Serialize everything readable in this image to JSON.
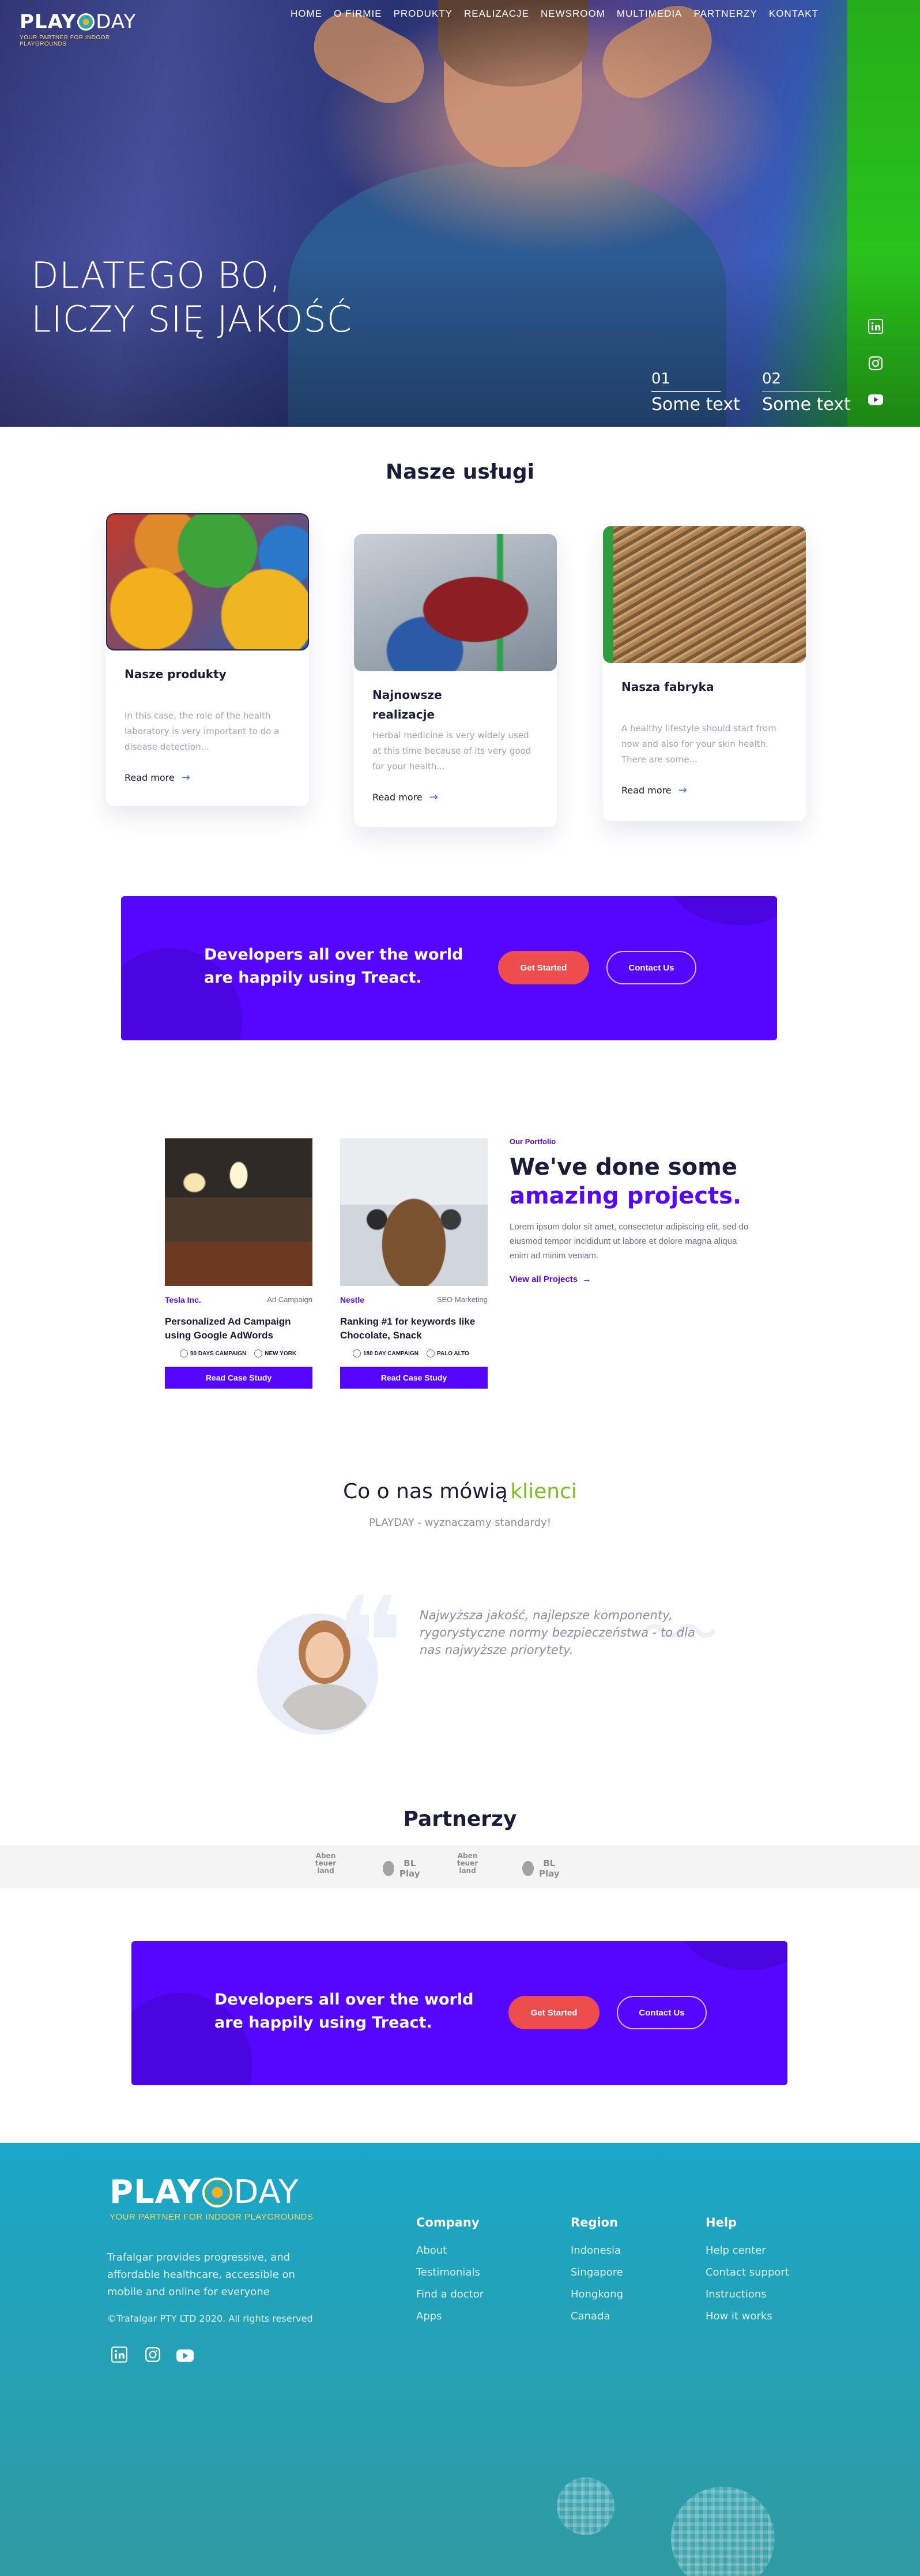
{
  "brand": {
    "name_left": "PLAY",
    "name_right": "DAY",
    "tagline": "YOUR PARTNER FOR INDOOR PLAYGROUNDS"
  },
  "nav": {
    "items": [
      "HOME",
      "O FIRMIE",
      "PRODUKTY",
      "REALIZACJE",
      "NEWSROOM",
      "MULTIMEDIA",
      "PARTNERZY",
      "KONTAKT"
    ]
  },
  "hero": {
    "title_line1": "DLATEGO BO,",
    "title_line2": "LICZY SIĘ JAKOŚĆ",
    "slides": [
      {
        "num": "01",
        "text": "Some text"
      },
      {
        "num": "02",
        "text": "Some text"
      }
    ]
  },
  "services": {
    "title": "Nasze usługi",
    "cards": [
      {
        "title": "Nasze produkty",
        "body": "In this case, the role of the health laboratory is very important to do a disease detection...",
        "link": "Read more"
      },
      {
        "title": "Najnowsze realizacje",
        "body": "Herbal medicine is very widely used at this time because of its very good for your health...",
        "link": "Read more"
      },
      {
        "title": "Nasza fabryka",
        "body": "A healthy lifestyle should start from now and also for your skin health. There are some...",
        "link": "Read more"
      }
    ]
  },
  "cta": {
    "text": "Developers all over the world are happily using Treact.",
    "primary": "Get Started",
    "secondary": "Contact Us"
  },
  "portfolio": {
    "eyebrow": "Our Portfolio",
    "heading_line1": "We've done some",
    "heading_line2": "amazing projects.",
    "body": "Lorem ipsum dolor sit amet, consectetur adipiscing elit, sed do eiusmod tempor incididunt ut labore et dolore magna aliqua enim ad minim veniam.",
    "view_all": "View all Projects",
    "cases": [
      {
        "client": "Tesla Inc.",
        "category": "Ad Campaign",
        "title": "Personalized Ad Campaign using Google AdWords",
        "tag1": "90 DAYS CAMPAIGN",
        "tag2": "NEW YORK",
        "button": "Read Case Study"
      },
      {
        "client": "Nestle",
        "category": "SEO Marketing",
        "title": "Ranking #1 for keywords like Chocolate, Snack",
        "tag1": "180 DAY CAMPAIGN",
        "tag2": "PALO ALTO",
        "button": "Read Case Study"
      }
    ]
  },
  "testimonials": {
    "title_main": "Co o nas mówią",
    "title_accent": "klienci",
    "subtitle": "PLAYDAY - wyznaczamy standardy!",
    "quote": "Najwyższa jakość, najlepsze komponenty, rygorystyczne normy bezpieczeństwa - to dla nas najwyższe priorytety."
  },
  "partners": {
    "title": "Partnerzy",
    "logos": [
      "Aben teuer land",
      "BL Play",
      "Aben teuer land",
      "BL Play"
    ]
  },
  "footer": {
    "about": "Trafalgar provides progressive, and affordable healthcare, accessible on mobile and online for everyone",
    "copyright": "©Trafalgar PTY LTD 2020. All rights reserved",
    "columns": [
      {
        "head": "Company",
        "links": [
          "About",
          "Testimonials",
          "Find a doctor",
          "Apps"
        ]
      },
      {
        "head": "Region",
        "links": [
          "Indonesia",
          "Singapore",
          "Hongkong",
          "Canada"
        ]
      },
      {
        "head": "Help",
        "links": [
          "Help center",
          "Contact support",
          "Instructions",
          "How it works"
        ]
      }
    ]
  },
  "colors": {
    "accent_purple": "#5406ff",
    "cta_red": "#ee4d4d",
    "accent_green": "#7bbf1f",
    "footer_teal": "#1aa7c9"
  }
}
